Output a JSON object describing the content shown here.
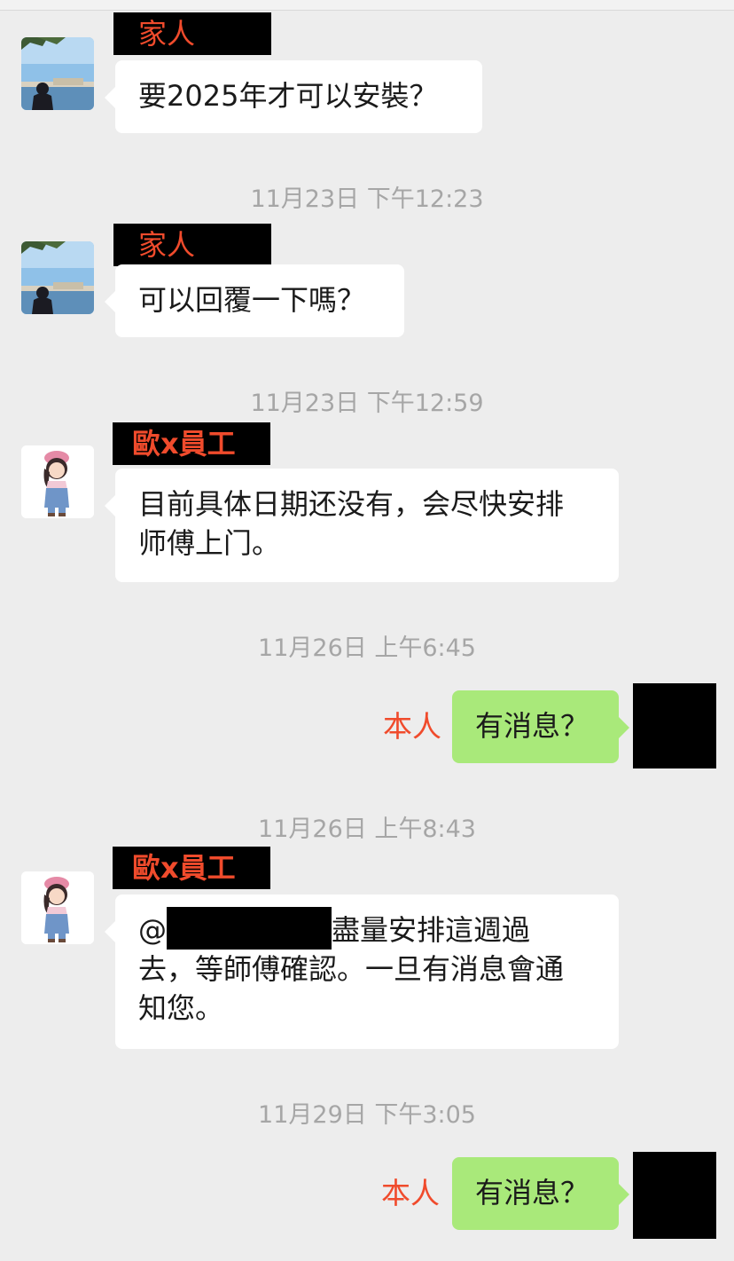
{
  "messages": [
    {
      "sender": "家人",
      "text": "要2025年才可以安裝？"
    },
    {
      "timestamp": "11月23日 下午12:23"
    },
    {
      "sender": "家人",
      "text": "可以回覆一下嗎？"
    },
    {
      "timestamp": "11月23日 下午12:59"
    },
    {
      "sender": "歐x員工",
      "line1": "目前具体日期还没有，会尽快安排",
      "line2": "师傅上门。"
    },
    {
      "timestamp": "11月26日 上午6:45"
    },
    {
      "sender": "本人",
      "text": "有消息？"
    },
    {
      "timestamp": "11月26日 上午8:43"
    },
    {
      "sender": "歐x員工",
      "prefix": "@",
      "line1_rest": "盡量安排這週過",
      "line2": "去，等師傅確認。一旦有消息會通",
      "line3": "知您。"
    },
    {
      "timestamp": "11月29日 下午3:05"
    },
    {
      "sender": "本人",
      "text": "有消息？"
    }
  ],
  "colors": {
    "background": "#ededed",
    "incoming_bubble": "#ffffff",
    "outgoing_bubble": "#a9e97a",
    "name_red": "#f04b2c",
    "timestamp": "#a6a6a6"
  },
  "icons": {
    "family_avatar": "landscape-avatar-icon",
    "staff_avatar": "cartoon-girl-avatar-icon"
  }
}
